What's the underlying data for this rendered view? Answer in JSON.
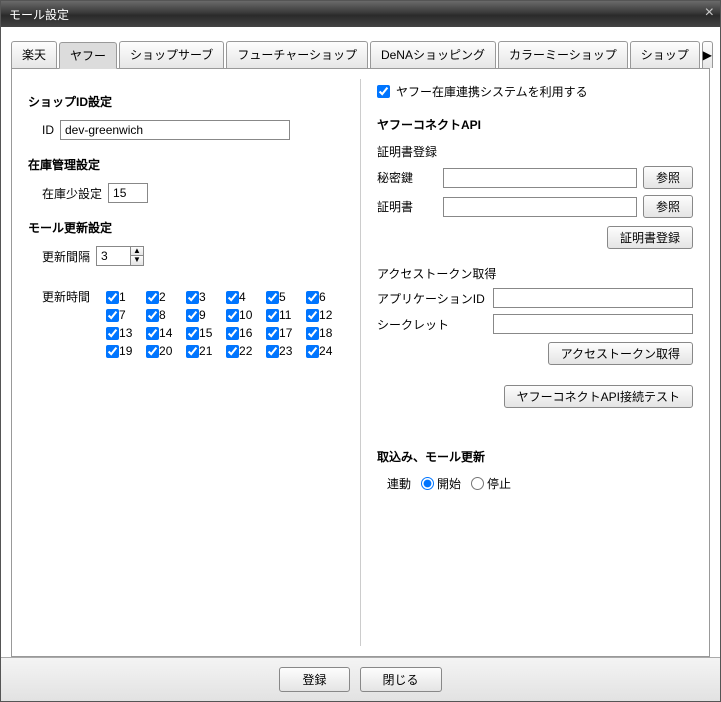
{
  "window": {
    "title": "モール設定"
  },
  "tabs": [
    "楽天",
    "ヤフー",
    "ショップサーブ",
    "フューチャーショップ",
    "DeNAショッピング",
    "カラーミーショップ",
    "ショップ"
  ],
  "active_tab_index": 1,
  "left": {
    "shop_id_section": "ショップID設定",
    "id_label": "ID",
    "id_value": "dev-greenwich",
    "inventory_section": "在庫管理設定",
    "low_stock_label": "在庫少設定",
    "low_stock_value": "15",
    "update_section": "モール更新設定",
    "interval_label": "更新間隔",
    "interval_value": "3",
    "update_time_label": "更新時間",
    "hours": [
      "1",
      "2",
      "3",
      "4",
      "5",
      "6",
      "7",
      "8",
      "9",
      "10",
      "11",
      "12",
      "13",
      "14",
      "15",
      "16",
      "17",
      "18",
      "19",
      "20",
      "21",
      "22",
      "23",
      "24"
    ]
  },
  "right": {
    "use_system_label": "ヤフー在庫連携システムを利用する",
    "connect_api_title": "ヤフーコネクトAPI",
    "cert_reg_label": "証明書登録",
    "secret_key_label": "秘密鍵",
    "cert_label": "証明書",
    "browse_btn": "参照",
    "cert_reg_btn": "証明書登録",
    "token_section": "アクセストークン取得",
    "app_id_label": "アプリケーションID",
    "secret_label": "シークレット",
    "get_token_btn": "アクセストークン取得",
    "test_btn": "ヤフーコネクトAPI接続テスト",
    "import_section": "取込み、モール更新",
    "link_label": "連動",
    "start_label": "開始",
    "stop_label": "停止"
  },
  "footer": {
    "register": "登録",
    "close": "閉じる"
  }
}
